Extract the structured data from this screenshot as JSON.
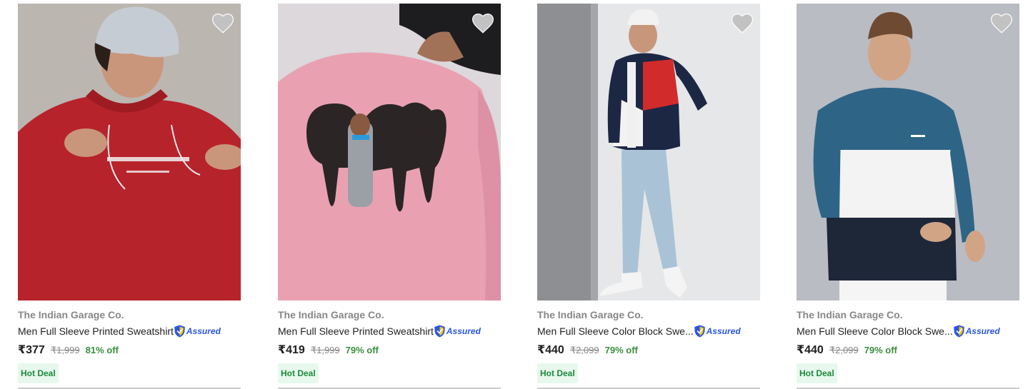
{
  "products": [
    {
      "brand": "The Indian Garage Co.",
      "title": "Men Full Sleeve Printed Sweatshirt",
      "assured_label": "Assured",
      "price": "₹377",
      "mrp": "₹1,999",
      "discount": "81% off",
      "badge": "Hot Deal",
      "image": "red hooded sweatshirt with MINIMALIST print, model in grey beanie"
    },
    {
      "brand": "The Indian Garage Co.",
      "title": "Men Full Sleeve Printed Sweatshirt",
      "assured_label": "Assured",
      "price": "₹419",
      "mrp": "₹1,999",
      "discount": "79% off",
      "badge": "Hot Deal",
      "image": "pink sweatshirt back with DRIP graffiti print, model in black bucket hat"
    },
    {
      "brand": "The Indian Garage Co.",
      "title": "Men Full Sleeve Color Block Swe...",
      "assured_label": "Assured",
      "price": "₹440",
      "mrp": "₹2,099",
      "discount": "79% off",
      "badge": "Hot Deal",
      "image": "navy red white color block zip jacket, model standing full length"
    },
    {
      "brand": "The Indian Garage Co.",
      "title": "Men Full Sleeve Color Block Swe...",
      "assured_label": "Assured",
      "price": "₹440",
      "mrp": "₹2,099",
      "discount": "79% off",
      "badge": "Hot Deal",
      "image": "teal white navy color block crew sweatshirt"
    }
  ],
  "colors": {
    "brand_text": "#878787",
    "price_text": "#212121",
    "discount": "#388e3c",
    "assured_blue": "#2a55e5",
    "badge_bg": "#e7f8ec",
    "badge_text": "#1c8a3c",
    "wishlist_icon": "#c2c2c2"
  },
  "icons": {
    "wishlist": "heart-icon",
    "assured": "shield-assured-icon"
  }
}
